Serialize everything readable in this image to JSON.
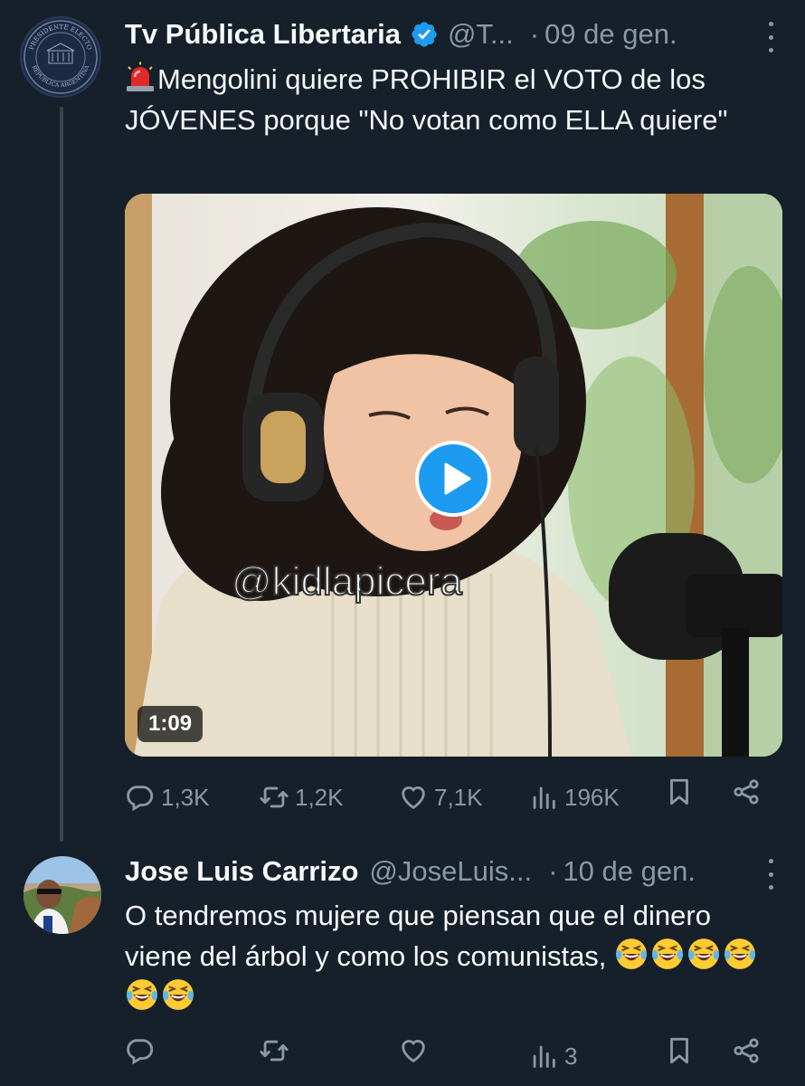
{
  "tweets": [
    {
      "author_name": "Tv Pública Libertaria",
      "handle": "@T...",
      "date": "09 de gen.",
      "text": "Mengolini quiere PROHIBIR el VOTO de los JÓVENES porque \"No votan como ELLA quiere\"",
      "avatar_text": {
        "top": "PRESIDENTE ELECTO",
        "bottom": "REPÚBLICA ARGENTINA"
      },
      "media": {
        "watermark": "@kidlapicera",
        "duration": "1:09"
      },
      "stats": {
        "replies": "1,3K",
        "retweets": "1,2K",
        "likes": "7,1K",
        "views": "196K"
      }
    },
    {
      "author_name": "Jose Luis Carrizo",
      "handle": "@JoseLuis...",
      "date": "10 de gen.",
      "text": "O tendremos mujere que piensan que el dinero viene del árbol y como los comunistas,",
      "emoji_count": 6,
      "stats": {
        "replies": "",
        "retweets": "",
        "likes": "",
        "views": "3"
      }
    }
  ],
  "dot": "·",
  "colors": {
    "background": "#15202b",
    "muted": "#8b98a5",
    "accent": "#1d9bf0",
    "text": "#f7f9f9"
  },
  "icons": [
    "reply-icon",
    "retweet-icon",
    "like-icon",
    "views-icon",
    "bookmark-icon",
    "share-icon",
    "verified-badge-icon",
    "siren-icon",
    "play-icon",
    "more-icon"
  ]
}
